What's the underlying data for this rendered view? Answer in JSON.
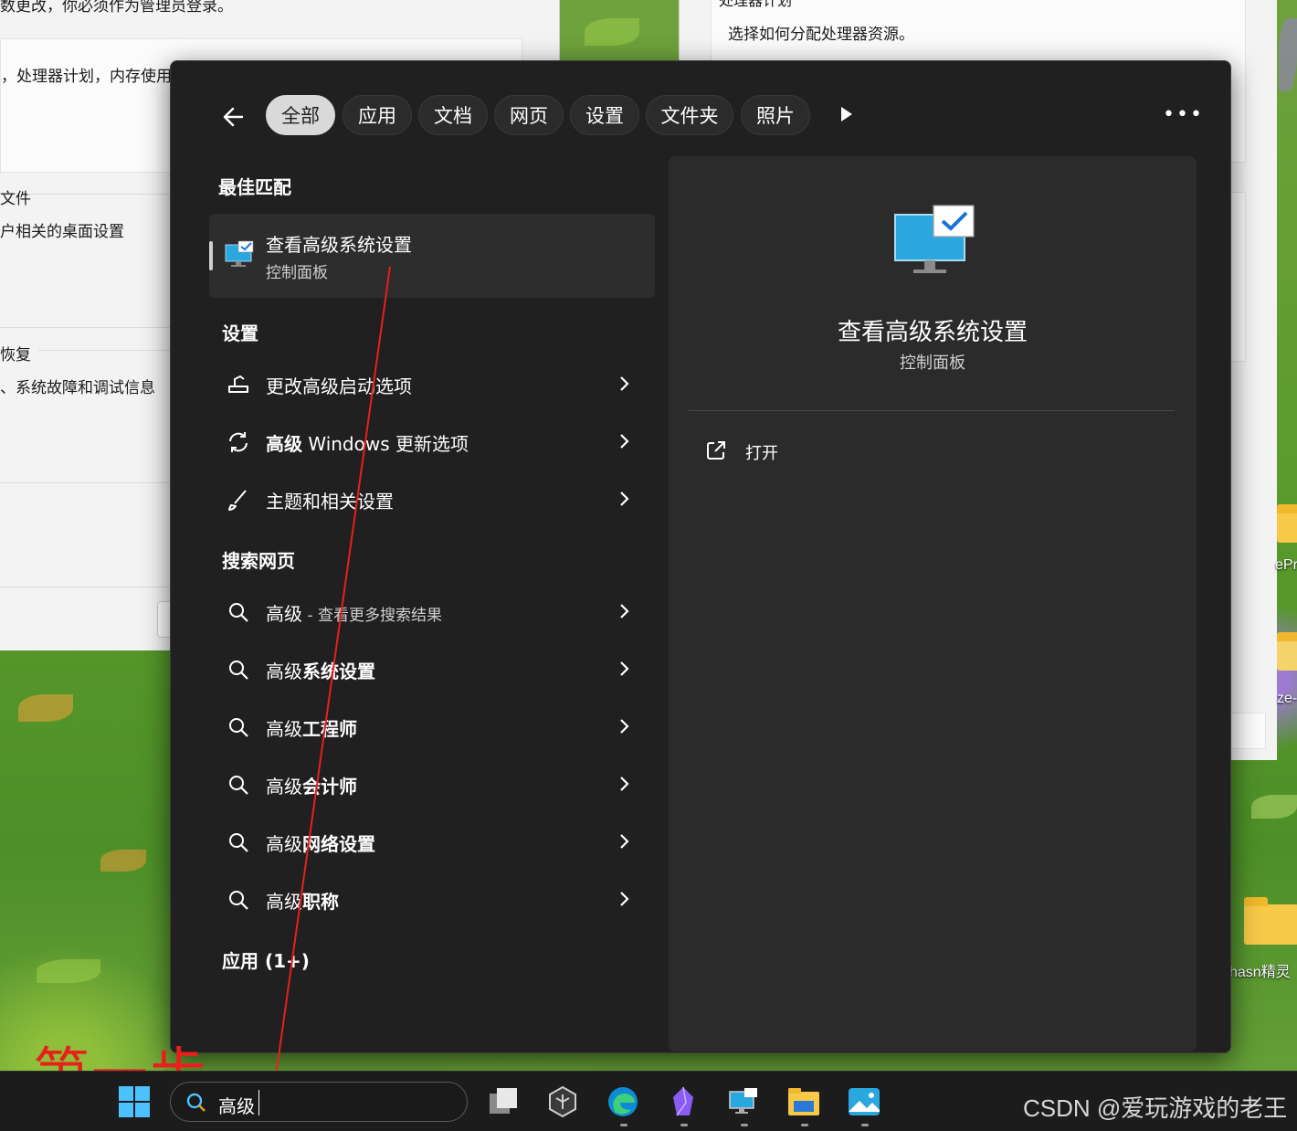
{
  "background_windows": {
    "left": {
      "line_top": "数更改，你必须作为管理员登录。",
      "line_processor": "，处理器计划，内存使用",
      "section_profile": "文件",
      "line_profile": "户相关的桌面设置",
      "section_recovery": "恢复",
      "line_recovery": "、系统故障和调试信息"
    },
    "right": {
      "title": "处理器计划",
      "desc": "选择如何分配处理器资源。"
    }
  },
  "desktop_labels": {
    "item1": "ePr",
    "item2": "ze-",
    "item3": "hasn精灵"
  },
  "search": {
    "tabs": [
      "全部",
      "应用",
      "文档",
      "网页",
      "设置",
      "文件夹",
      "照片"
    ],
    "active_tab": "全部",
    "best_match_header": "最佳匹配",
    "best_match": {
      "title": "查看高级系统设置",
      "subtitle": "控制面板"
    },
    "settings_header": "设置",
    "settings": [
      {
        "icon": "startup-options-icon",
        "text": "更改高级启动选项"
      },
      {
        "icon": "sync-icon",
        "bold": "高级",
        "text": " Windows 更新选项"
      },
      {
        "icon": "brush-icon",
        "text": "主题和相关设置"
      }
    ],
    "web_header": "搜索网页",
    "web": [
      {
        "prefix": "高级",
        "suffix": " - 查看更多搜索结果",
        "suffix_dim": true
      },
      {
        "prefix": "高级",
        "suffix": "系统设置"
      },
      {
        "prefix": "高级",
        "suffix": "工程师"
      },
      {
        "prefix": "高级",
        "suffix": "会计师"
      },
      {
        "prefix": "高级",
        "suffix": "网络设置"
      },
      {
        "prefix": "高级",
        "suffix": "职称"
      }
    ],
    "apps_header": "应用 (1+)",
    "preview": {
      "title": "查看高级系统设置",
      "subtitle": "控制面板",
      "open_label": "打开"
    }
  },
  "annotation": {
    "step_label": "第一步",
    "color": "#e8201c"
  },
  "taskbar": {
    "search_query": "高级",
    "apps": [
      "task-view-icon",
      "unity-hub-icon",
      "edge-icon",
      "obsidian-icon",
      "remote-desktop-icon",
      "file-explorer-icon",
      "photos-icon"
    ]
  },
  "watermark": "CSDN @爱玩游戏的老王"
}
